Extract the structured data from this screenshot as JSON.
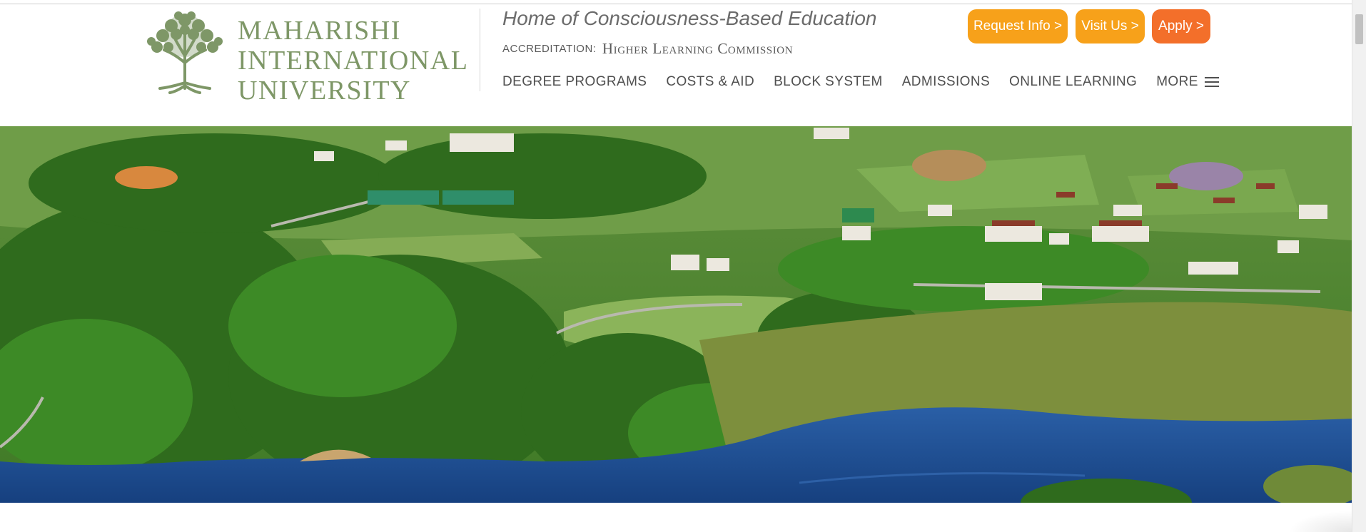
{
  "logo": {
    "line1": "MAHARISHI",
    "line2": "INTERNATIONAL",
    "line3": "UNIVERSITY",
    "color": "#7e9767"
  },
  "header": {
    "tagline": "Home of Consciousness-Based Education",
    "accreditation_label": "ACCREDITATION:",
    "accreditation_value": "Higher Learning Commission"
  },
  "cta": {
    "request_info": "Request Info >",
    "visit_us": "Visit Us >",
    "apply": "Apply >",
    "orange": "#f7a11a",
    "apply_color": "#f36f2a"
  },
  "nav": {
    "items": [
      {
        "label": "DEGREE PROGRAMS"
      },
      {
        "label": "COSTS & AID"
      },
      {
        "label": "BLOCK SYSTEM"
      },
      {
        "label": "ADMISSIONS"
      },
      {
        "label": "ONLINE LEARNING"
      },
      {
        "label": "MORE",
        "icon": "hamburger-icon"
      }
    ]
  }
}
